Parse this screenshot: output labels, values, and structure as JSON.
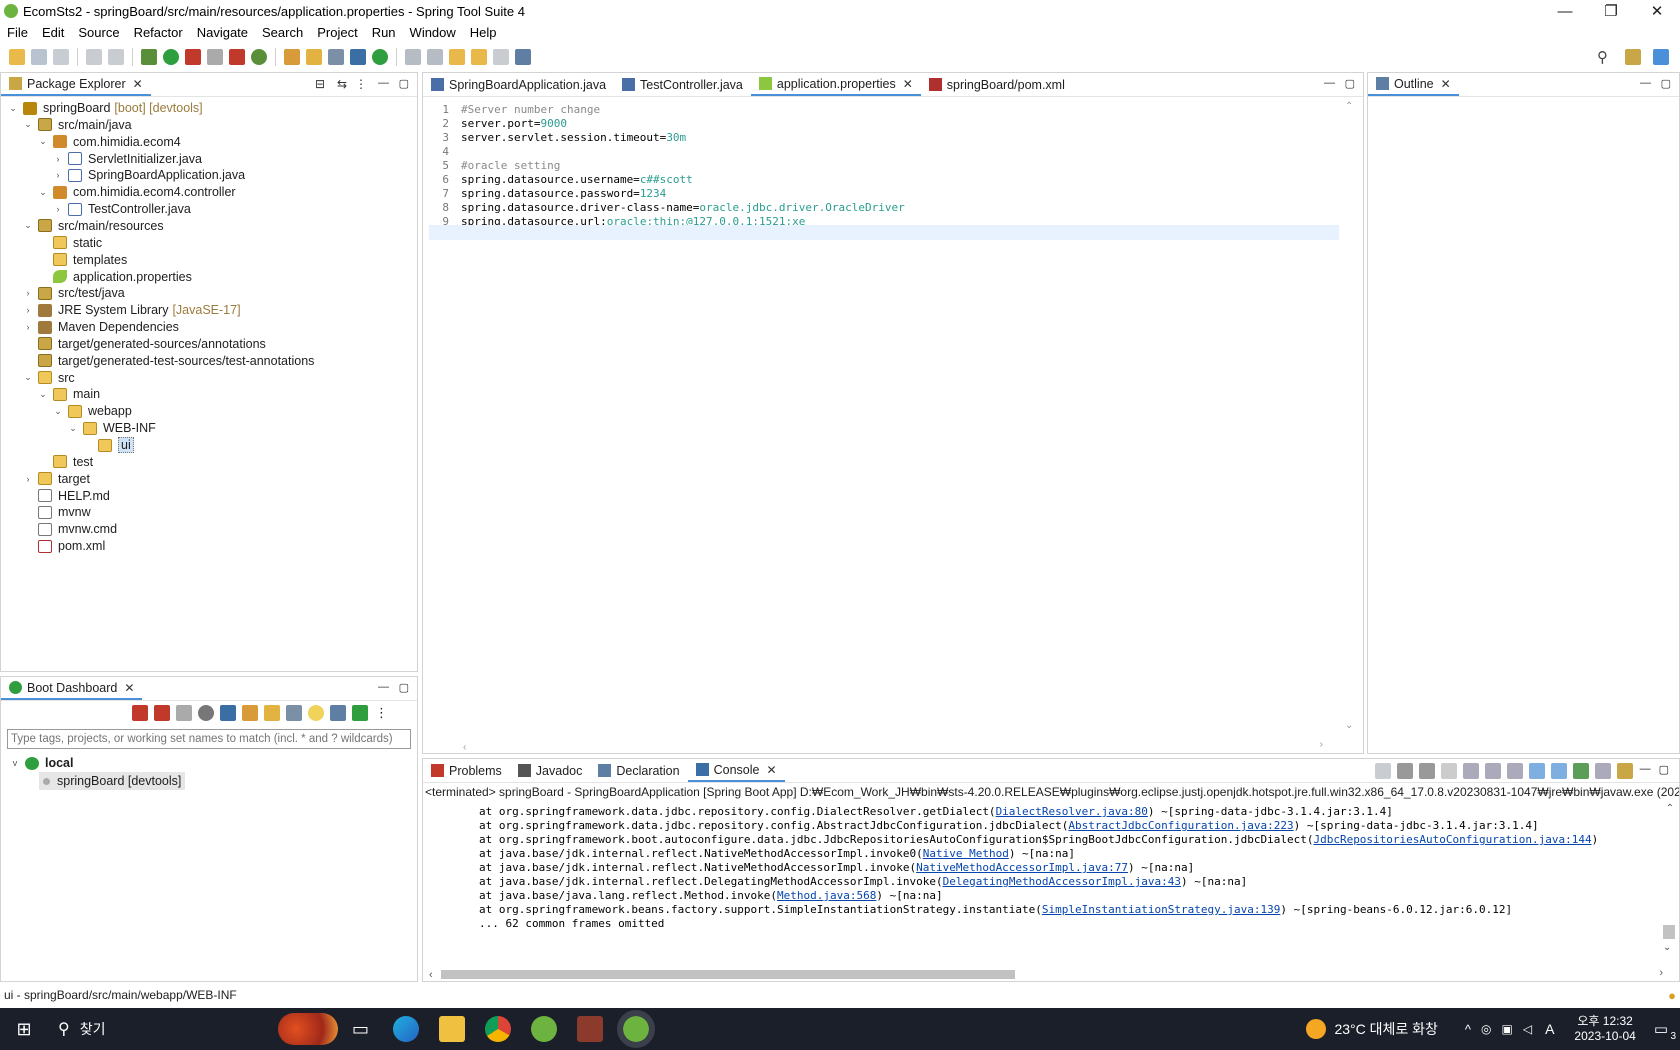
{
  "window": {
    "title": "EcomSts2 - springBoard/src/main/resources/application.properties - Spring Tool Suite 4",
    "controls": [
      "—",
      "❐",
      "✕"
    ]
  },
  "menu": [
    "File",
    "Edit",
    "Source",
    "Refactor",
    "Navigate",
    "Search",
    "Project",
    "Run",
    "Window",
    "Help"
  ],
  "package_explorer": {
    "tab_label": "Package Explorer",
    "tree": [
      {
        "label": "springBoard",
        "deco": "[boot] [devtools]",
        "depth": 0,
        "twisty": "v",
        "icon": "proj"
      },
      {
        "label": "src/main/java",
        "depth": 1,
        "twisty": "v",
        "icon": "srcf"
      },
      {
        "label": "com.himidia.ecom4",
        "depth": 2,
        "twisty": "v",
        "icon": "pkg"
      },
      {
        "label": "ServletInitializer.java",
        "depth": 3,
        "twisty": ">",
        "icon": "java"
      },
      {
        "label": "SpringBoardApplication.java",
        "depth": 3,
        "twisty": ">",
        "icon": "java"
      },
      {
        "label": "com.himidia.ecom4.controller",
        "depth": 2,
        "twisty": "v",
        "icon": "pkg"
      },
      {
        "label": "TestController.java",
        "depth": 3,
        "twisty": ">",
        "icon": "java"
      },
      {
        "label": "src/main/resources",
        "depth": 1,
        "twisty": "v",
        "icon": "srcf"
      },
      {
        "label": "static",
        "depth": 2,
        "twisty": "",
        "icon": "folder"
      },
      {
        "label": "templates",
        "depth": 2,
        "twisty": "",
        "icon": "folder"
      },
      {
        "label": "application.properties",
        "depth": 2,
        "twisty": "",
        "icon": "props"
      },
      {
        "label": "src/test/java",
        "depth": 1,
        "twisty": ">",
        "icon": "srcf"
      },
      {
        "label": "JRE System Library",
        "deco": "[JavaSE-17]",
        "depth": 1,
        "twisty": ">",
        "icon": "lib"
      },
      {
        "label": "Maven Dependencies",
        "depth": 1,
        "twisty": ">",
        "icon": "lib"
      },
      {
        "label": "target/generated-sources/annotations",
        "depth": 1,
        "twisty": "",
        "icon": "srcf"
      },
      {
        "label": "target/generated-test-sources/test-annotations",
        "depth": 1,
        "twisty": "",
        "icon": "srcf"
      },
      {
        "label": "src",
        "depth": 1,
        "twisty": "v",
        "icon": "folder"
      },
      {
        "label": "main",
        "depth": 2,
        "twisty": "v",
        "icon": "folder"
      },
      {
        "label": "webapp",
        "depth": 3,
        "twisty": "v",
        "icon": "folder"
      },
      {
        "label": "WEB-INF",
        "depth": 4,
        "twisty": "v",
        "icon": "folder"
      },
      {
        "label": "ui",
        "depth": 5,
        "twisty": "",
        "icon": "folder",
        "selected": true
      },
      {
        "label": "test",
        "depth": 2,
        "twisty": "",
        "icon": "folder"
      },
      {
        "label": "target",
        "depth": 1,
        "twisty": ">",
        "icon": "folder"
      },
      {
        "label": "HELP.md",
        "depth": 1,
        "twisty": "",
        "icon": "file"
      },
      {
        "label": "mvnw",
        "depth": 1,
        "twisty": "",
        "icon": "file"
      },
      {
        "label": "mvnw.cmd",
        "depth": 1,
        "twisty": "",
        "icon": "file"
      },
      {
        "label": "pom.xml",
        "depth": 1,
        "twisty": "",
        "icon": "xml"
      }
    ]
  },
  "editor": {
    "tabs": [
      {
        "label": "SpringBoardApplication.java",
        "active": false
      },
      {
        "label": "TestController.java",
        "active": false
      },
      {
        "label": "application.properties",
        "active": true
      },
      {
        "label": "springBoard/pom.xml",
        "active": false
      }
    ],
    "lines": [
      {
        "n": "1",
        "key": "#Server number change",
        "val": "",
        "comment": true
      },
      {
        "n": "2",
        "key": "server.port=",
        "val": "9000"
      },
      {
        "n": "3",
        "key": "server.servlet.session.timeout=",
        "val": "30m"
      },
      {
        "n": "4",
        "key": "",
        "val": ""
      },
      {
        "n": "5",
        "key": "#oracle setting",
        "val": "",
        "comment": true
      },
      {
        "n": "6",
        "key": "spring.datasource.username=",
        "val": "c##scott"
      },
      {
        "n": "7",
        "key": "spring.datasource.password=",
        "val": "1234"
      },
      {
        "n": "8",
        "key": "spring.datasource.driver-class-name=",
        "val": "oracle.jdbc.driver.OracleDriver"
      },
      {
        "n": "9",
        "key": "spring.datasource.url:",
        "val": "oracle:thin:@127.0.0.1:1521:xe"
      },
      {
        "n": "10",
        "key": "",
        "val": ""
      }
    ]
  },
  "outline": {
    "tab_label": "Outline"
  },
  "boot_dashboard": {
    "tab_label": "Boot Dashboard",
    "filter_placeholder": "Type tags, projects, or working set names to match (incl. * and ? wildcards)",
    "group": "local",
    "app": "springBoard [devtools]"
  },
  "bottom_panel": {
    "tabs": [
      {
        "label": "Problems",
        "active": false
      },
      {
        "label": "Javadoc",
        "active": false
      },
      {
        "label": "Declaration",
        "active": false
      },
      {
        "label": "Console",
        "active": true
      }
    ],
    "header": "<terminated> springBoard - SpringBoardApplication [Spring Boot App] D:₩Ecom_Work_JH₩bin₩sts-4.20.0.RELEASE₩plugins₩org.eclipse.justj.openjdk.hotspot.jre.full.win32.x86_64_17.0.8.v20230831-1047₩jre₩bin₩javaw.exe  (2023",
    "lines": [
      {
        "pre": "at org.springframework.data.jdbc.repository.config.DialectResolver.getDialect(",
        "link": "DialectResolver.java:80",
        "post": ") ~[spring-data-jdbc-3.1.4.jar:3.1.4]"
      },
      {
        "pre": "at org.springframework.data.jdbc.repository.config.AbstractJdbcConfiguration.jdbcDialect(",
        "link": "AbstractJdbcConfiguration.java:223",
        "post": ") ~[spring-data-jdbc-3.1.4.jar:3.1.4]"
      },
      {
        "pre": "at org.springframework.boot.autoconfigure.data.jdbc.JdbcRepositoriesAutoConfiguration$SpringBootJdbcConfiguration.jdbcDialect(",
        "link": "JdbcRepositoriesAutoConfiguration.java:144",
        "post": ")"
      },
      {
        "pre": "at java.base/jdk.internal.reflect.NativeMethodAccessorImpl.invoke0(",
        "link": "Native Method",
        "post": ") ~[na:na]"
      },
      {
        "pre": "at java.base/jdk.internal.reflect.NativeMethodAccessorImpl.invoke(",
        "link": "NativeMethodAccessorImpl.java:77",
        "post": ") ~[na:na]"
      },
      {
        "pre": "at java.base/jdk.internal.reflect.DelegatingMethodAccessorImpl.invoke(",
        "link": "DelegatingMethodAccessorImpl.java:43",
        "post": ") ~[na:na]"
      },
      {
        "pre": "at java.base/java.lang.reflect.Method.invoke(",
        "link": "Method.java:568",
        "post": ") ~[na:na]"
      },
      {
        "pre": "at org.springframework.beans.factory.support.SimpleInstantiationStrategy.instantiate(",
        "link": "SimpleInstantiationStrategy.java:139",
        "post": ") ~[spring-beans-6.0.12.jar:6.0.12]"
      },
      {
        "pre": "... 62 common frames omitted",
        "link": "",
        "post": ""
      }
    ]
  },
  "status": {
    "text": "ui - springBoard/src/main/webapp/WEB-INF"
  },
  "taskbar": {
    "search_text": "찾기",
    "weather": "23°C  대체로 화창",
    "time": "오후 12:32",
    "date": "2023-10-04",
    "notification_count": "3",
    "ime": "A"
  },
  "colors": {
    "accent": "#4a90d9",
    "prop_value": "#2a9d8f",
    "link": "#0645ad",
    "taskbar": "#1b1f2a"
  }
}
